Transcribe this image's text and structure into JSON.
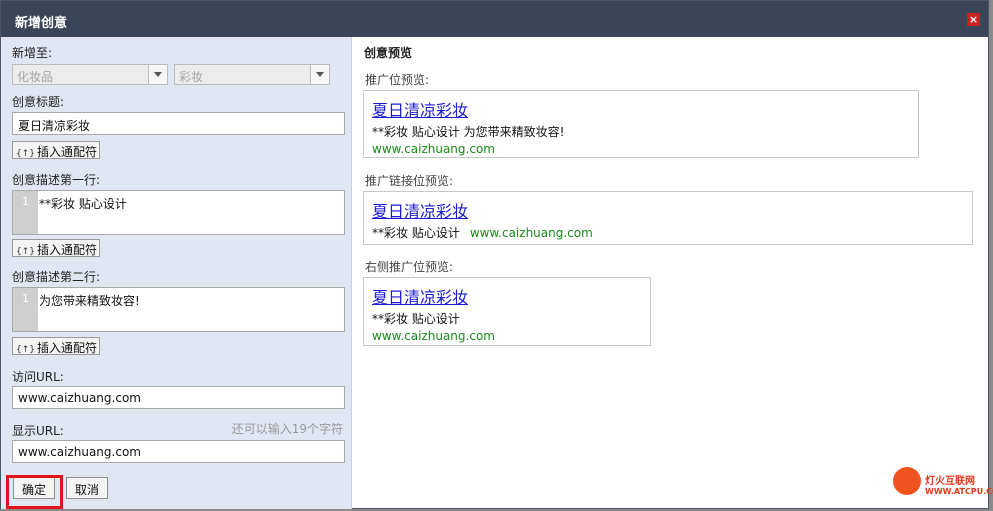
{
  "dialog": {
    "title": "新增创意",
    "close_label": "×"
  },
  "form": {
    "add_to_label": "新增至:",
    "add_to_campaign": "化妆品",
    "add_to_group": "彩妆",
    "title_label": "创意标题:",
    "title_value": "夏日清凉彩妆",
    "wildcard_label": "插入通配符",
    "wildcard_icon": "{↑}",
    "desc1_label": "创意描述第一行:",
    "desc1_line_no": "1",
    "desc1_value": "**彩妆 贴心设计",
    "desc2_label": "创意描述第二行:",
    "desc2_line_no": "1",
    "desc2_value": "为您带来精致妆容!",
    "visit_url_label": "访问URL:",
    "visit_url_value": "www.caizhuang.com",
    "display_url_label": "显示URL:",
    "display_url_value": "www.caizhuang.com",
    "char_hint": "还可以输入19个字符",
    "ok_label": "确定",
    "cancel_label": "取消"
  },
  "preview": {
    "heading": "创意预览",
    "promo_label": "推广位预览:",
    "promo": {
      "title": "夏日清凉彩妆",
      "desc": "**彩妆  贴心设计  为您带来精致妆容!",
      "url": "www.caizhuang.com"
    },
    "link_label": "推广链接位预览:",
    "link": {
      "title": "夏日清凉彩妆",
      "desc": "**彩妆  贴心设计",
      "url": "www.caizhuang.com"
    },
    "right_label": "右侧推广位预览:",
    "right_slot": {
      "title": "夏日清凉彩妆",
      "desc": "**彩妆  贴心设计",
      "url": "www.caizhuang.com"
    }
  },
  "watermark": {
    "line1": "灯火互联网",
    "line2": "WWW.ATCPU.COM"
  },
  "colors": {
    "titlebar": "#3a4559",
    "left_panel": "#e1e6f3",
    "link_blue": "#1b1bd0",
    "url_green": "#1a8a1a",
    "highlight_red": "#e0141a"
  }
}
